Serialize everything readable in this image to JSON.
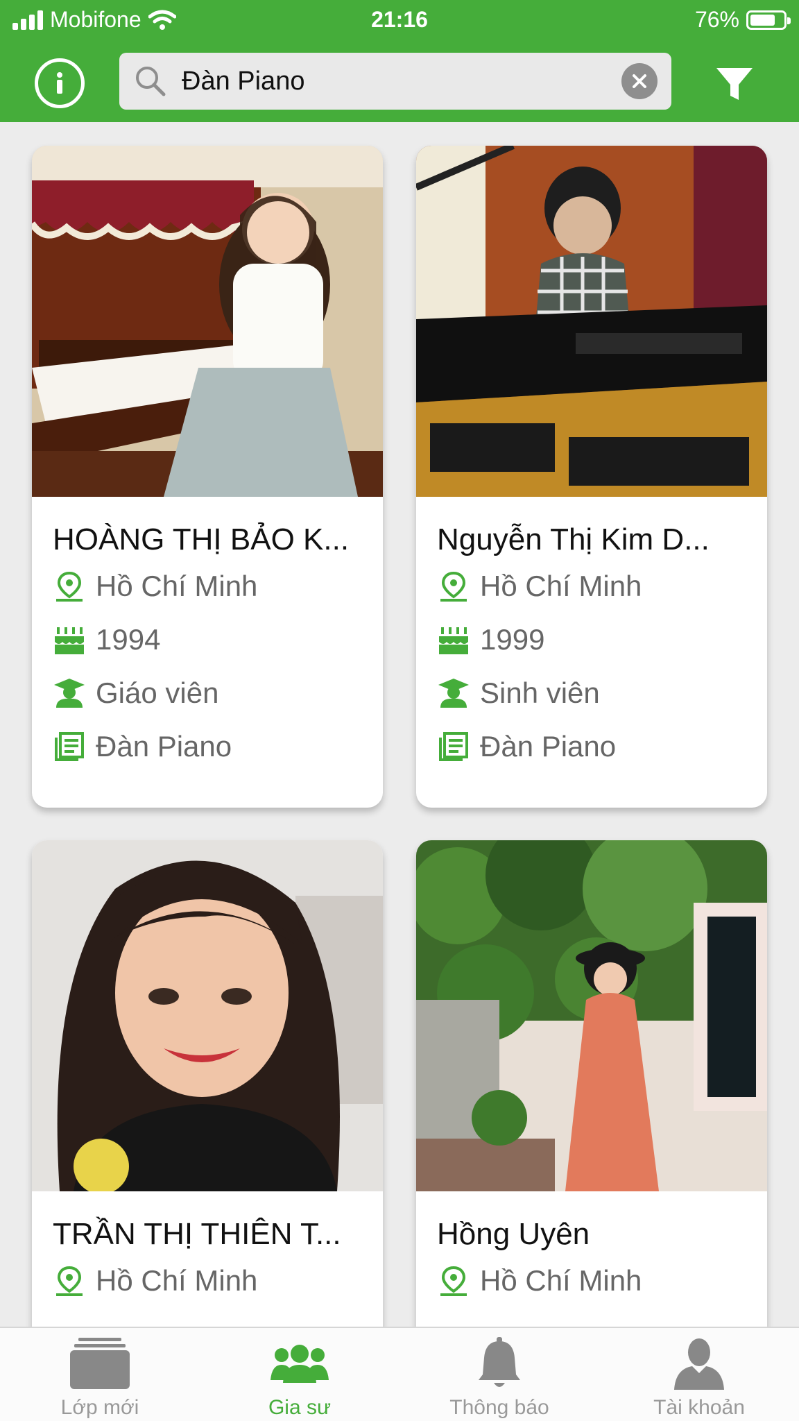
{
  "status_bar": {
    "carrier": "Mobifone",
    "time": "21:16",
    "battery": "76%",
    "battery_level": 0.76
  },
  "header": {
    "search_value": "Đàn Piano",
    "clear_icon": "clear-icon",
    "filter_icon": "filter-icon",
    "info_icon": "info-icon"
  },
  "tutors": [
    {
      "name": "HOÀNG THỊ BẢO K...",
      "location": "Hồ Chí Minh",
      "birth_year": "1994",
      "occupation": "Giáo viên",
      "subject": "Đàn Piano"
    },
    {
      "name": "Nguyễn Thị Kim D...",
      "location": "Hồ Chí Minh",
      "birth_year": "1999",
      "occupation": "Sinh viên",
      "subject": "Đàn Piano"
    },
    {
      "name": "TRẦN THỊ THIÊN T...",
      "location": "Hồ Chí Minh"
    },
    {
      "name": "Hồng Uyên",
      "location": "Hồ Chí Minh"
    }
  ],
  "tabbar": {
    "tabs": [
      {
        "label": "Lớp mới",
        "icon": "classes-icon"
      },
      {
        "label": "Gia sư",
        "icon": "tutors-icon",
        "active": true
      },
      {
        "label": "Thông báo",
        "icon": "bell-icon"
      },
      {
        "label": "Tài khoản",
        "icon": "account-icon"
      }
    ]
  },
  "colors": {
    "brand_green": "#45ad3a",
    "tab_inactive": "#999999",
    "text_gray": "#666666"
  }
}
